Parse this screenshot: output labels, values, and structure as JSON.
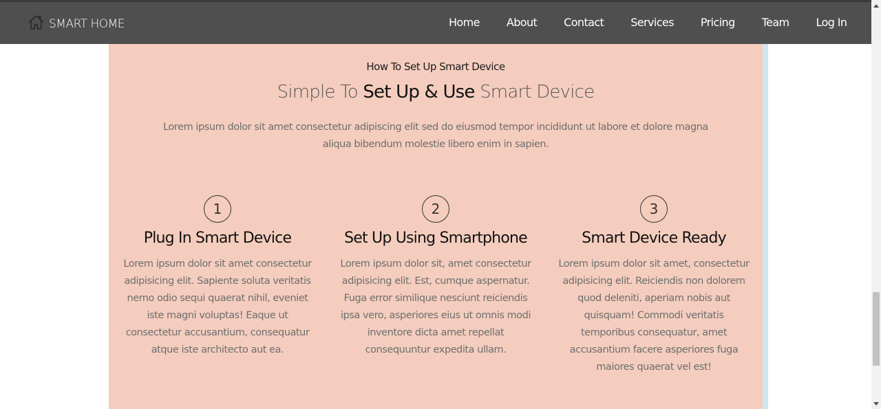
{
  "brand": {
    "name": "SMART HOME",
    "icon": "home-icon"
  },
  "nav": {
    "items": [
      {
        "label": "Home"
      },
      {
        "label": "About"
      },
      {
        "label": "Contact"
      },
      {
        "label": "Services"
      },
      {
        "label": "Pricing"
      },
      {
        "label": "Team"
      },
      {
        "label": "Log In"
      }
    ]
  },
  "section": {
    "overline": "How To Set Up Smart Device",
    "heading_pre": "Simple To ",
    "heading_strong": "Set Up & Use",
    "heading_post": " Smart Device",
    "lead": "Lorem ipsum dolor sit amet consectetur adipiscing elit sed do eiusmod tempor incididunt ut labore et dolore magna aliqua bibendum molestie libero enim in sapien.",
    "steps": [
      {
        "number": "1",
        "title": "Plug In Smart Device",
        "text": "Lorem ipsum dolor sit amet consectetur adipisicing elit. Sapiente soluta veritatis nemo odio sequi quaerat nihil, eveniet iste magni voluptas! Eaque ut consectetur accusantium, consequatur atque iste architecto aut ea."
      },
      {
        "number": "2",
        "title": "Set Up Using Smartphone",
        "text": "Lorem ipsum dolor sit, amet consectetur adipisicing elit. Est, cumque aspernatur. Fuga error similique nesciunt reiciendis ipsa vero, asperiores eius ut omnis modi inventore dicta amet repellat consequuntur expedita ullam."
      },
      {
        "number": "3",
        "title": "Smart Device Ready",
        "text": "Lorem ipsum dolor sit amet, consectetur adipisicing elit. Reiciendis non dolorem quod deleniti, aperiam nobis aut quisquam! Commodi veritatis temporibus consequatur, amet accusantium facere asperiores fuga maiores quaerat vel est!"
      }
    ]
  },
  "colors": {
    "navbar": "#4f4f4f",
    "section_bg": "#f4cdbe",
    "text_muted": "#6e6e6e"
  }
}
